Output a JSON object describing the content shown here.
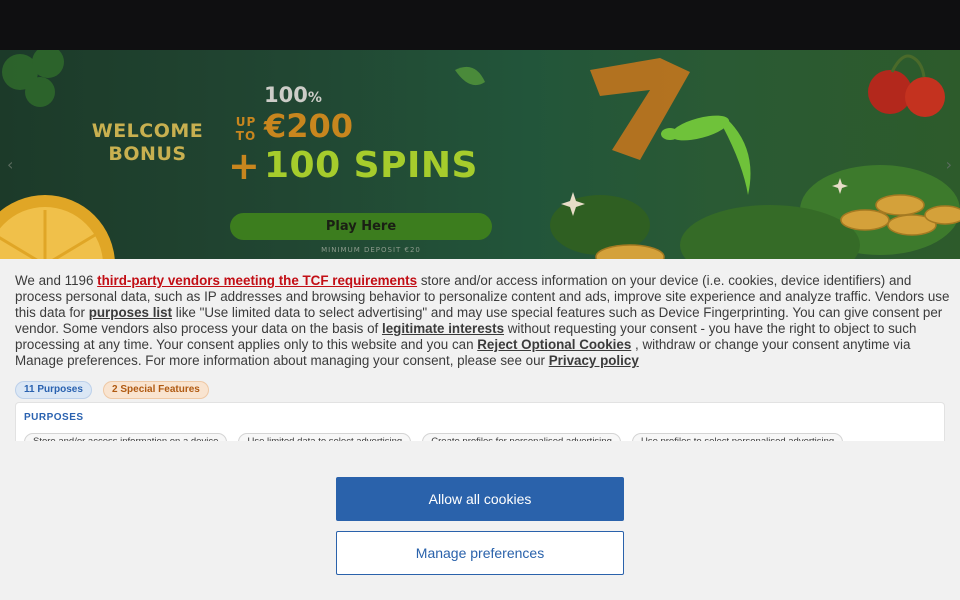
{
  "banner": {
    "welcome_line1": "WELCOME",
    "welcome_line2": "BONUS",
    "percent": "100",
    "percent_sign": "%",
    "up_to_1": "UP",
    "up_to_2": "TO",
    "amount": "€200",
    "plus": "+",
    "spins": "100 SPINS",
    "play_label": "Play Here",
    "min_deposit": "MINIMUM DEPOSIT €20",
    "prev_arrow": "‹",
    "next_arrow": "›"
  },
  "consent": {
    "t1": "We and 1196 ",
    "link_vendors": "third-party vendors meeting the TCF requirements",
    "t2": " store and/or access information on your device (i.e. cookies, device identifiers) and process personal data, such as IP addresses and browsing behavior to personalize content and ads, improve site experience and analyze traffic. Vendors use this data for ",
    "link_purposes": "purposes list",
    "t3": "  like \"Use limited data to select advertising\" and may use special features such as Device Fingerprinting. You can give consent per vendor. Some vendors also process your data on the basis of ",
    "link_legit": "legitimate interests",
    "t4": "  without requesting your consent - you have the right to object to such processing at any time. Your consent applies only to this website and you can ",
    "link_reject": "Reject Optional Cookies",
    "t5": " , withdraw or change your consent anytime via Manage preferences. For more information about managing your consent, please see our ",
    "link_privacy": "Privacy policy",
    "badge_purposes": "11 Purposes",
    "badge_features": "2 Special Features",
    "purposes_heading": "PURPOSES",
    "purposes": [
      "Store and/or access information on a device",
      "Use limited data to select advertising",
      "Create profiles for personalised advertising",
      "Use profiles to select personalised advertising"
    ],
    "allow_all": "Allow all cookies",
    "manage": "Manage preferences"
  },
  "colors": {
    "top_bar": "#0f0f11",
    "accent_blue": "#2a62ab",
    "vendor_link_red": "#c20e15",
    "spins_green": "#a6cc2c",
    "bonus_orange": "#c8861e"
  }
}
